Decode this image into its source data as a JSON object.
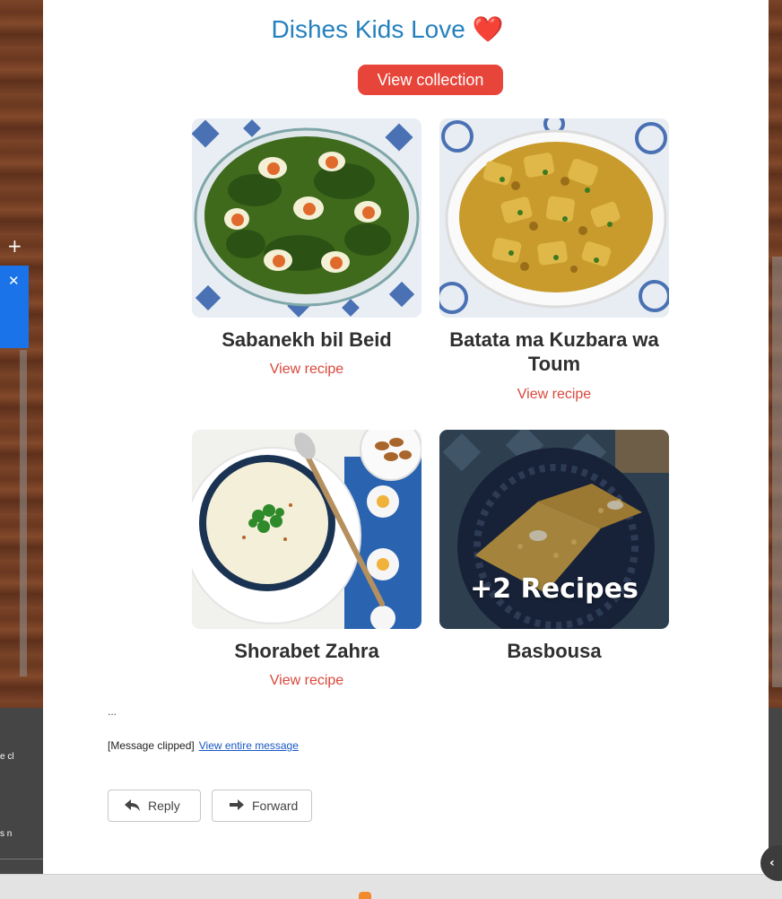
{
  "email": {
    "heading": "Dishes Kids Love",
    "heading_emoji": "❤️",
    "collection_button": "View collection",
    "recipes": [
      {
        "name": "Sabanekh bil Beid",
        "link": "View recipe"
      },
      {
        "name": "Batata ma Kuzbara wa Toum",
        "link": "View recipe"
      },
      {
        "name": "Shorabet Zahra",
        "link": "View recipe"
      },
      {
        "name": "Basbousa",
        "overlay": "+2 Recipes"
      }
    ],
    "ellipsis": "...",
    "clipped_text": "[Message clipped]",
    "view_entire_link": "View entire message"
  },
  "actions": {
    "reply": "Reply",
    "forward": "Forward"
  },
  "sidebar": {
    "add_symbol": "+",
    "close_symbol": "✕",
    "snippet_1": "e cl",
    "snippet_2": "s n"
  },
  "nav": {
    "collapse_symbol": "‹"
  },
  "colors": {
    "accent": "#2581be",
    "button_red": "#e8453a",
    "link_red": "#d9483c",
    "link_blue": "#1a58c2"
  }
}
